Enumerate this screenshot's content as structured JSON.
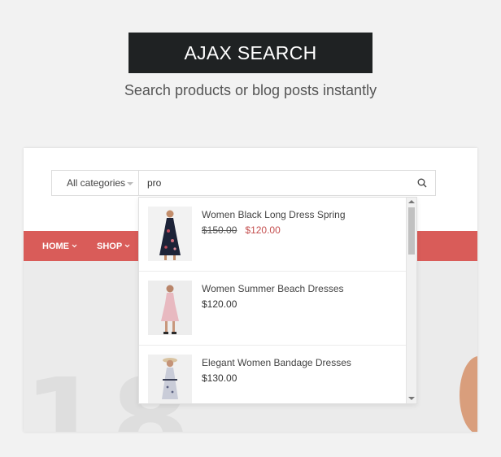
{
  "hero": {
    "title": "AJAX SEARCH",
    "subtitle": "Search products or blog posts instantly"
  },
  "search": {
    "category_label": "All categories",
    "query": "pro",
    "search_icon": "search-icon"
  },
  "nav": {
    "items": [
      {
        "label": "HOME",
        "icon": "chevron-down-icon"
      },
      {
        "label": "SHOP",
        "icon": "chevron-down-icon"
      }
    ],
    "accent_color": "#d95c59"
  },
  "results": [
    {
      "name": "Women Black Long Dress Spring",
      "old_price": "$150.00",
      "price": "$120.00",
      "on_sale": true
    },
    {
      "name": "Women Summer Beach Dresses",
      "price": "$120.00",
      "on_sale": false
    },
    {
      "name": "Elegant Women Bandage Dresses",
      "price": "$130.00",
      "on_sale": false
    }
  ],
  "background": {
    "banner_number": "18"
  },
  "colors": {
    "badge_bg": "#1f2223",
    "sale_price": "#c44f4f"
  }
}
